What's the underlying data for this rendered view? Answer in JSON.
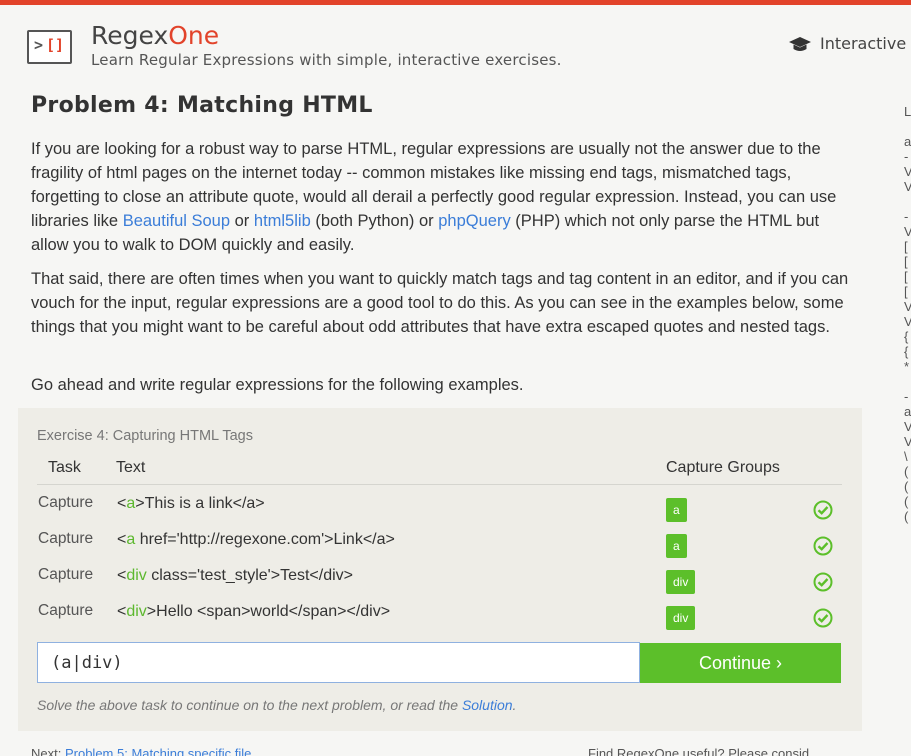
{
  "header": {
    "logo_left": ">",
    "logo_right": "[]",
    "brand_part1": "Regex",
    "brand_part2": "One",
    "tagline": "Learn Regular Expressions with simple, interactive exercises.",
    "nav_icon": "graduation-cap-icon",
    "nav_text": "Interactive T"
  },
  "page": {
    "title": "Problem 4: Matching HTML",
    "para1_a": "If you are looking for a robust way to parse HTML, regular expressions are usually not the answer due to the fragility of html pages on the internet today -- common mistakes like missing end tags, mismatched tags, forgetting to close an attribute quote, would all derail a perfectly good regular expression. Instead, you can use libraries like ",
    "link_bs": "Beautiful Soup",
    "para1_b": " or ",
    "link_html5lib": "html5lib",
    "para1_c": " (both Python) or ",
    "link_phpquery": "phpQuery",
    "para1_d": " (PHP) which not only parse the HTML but allow you to walk to DOM quickly and easily.",
    "para2": "That said, there are often times when you want to quickly match tags and tag content in an editor, and if you can vouch for the input, regular expressions are a good tool to do this. As you can see in the examples below, some things that you might want to be careful about odd attributes that have extra escaped quotes and nested tags.",
    "para3": "Go ahead and write regular expressions for the following examples."
  },
  "sidebar_letters": [
    "L",
    "",
    "a",
    "-",
    "V",
    "V",
    "",
    "-",
    "V",
    "[",
    "[",
    "[",
    "[",
    "V",
    "V",
    "{",
    "{",
    "*",
    "",
    "-",
    "a",
    "V",
    "V",
    "\\",
    "(",
    "(",
    "(",
    "("
  ],
  "exercise": {
    "title": "Exercise 4: Capturing HTML Tags",
    "col_task": "Task",
    "col_text": "Text",
    "col_groups": "Capture Groups",
    "rows": [
      {
        "task": "Capture",
        "pre": "<",
        "hl": "a",
        "post": ">This is a link</a>",
        "group": "a"
      },
      {
        "task": "Capture",
        "pre": "<",
        "hl": "a",
        "post": " href='http://regexone.com'>Link</a>",
        "group": "a"
      },
      {
        "task": "Capture",
        "pre": "<",
        "hl": "div",
        "post": " class='test_style'>Test</div>",
        "group": "div"
      },
      {
        "task": "Capture",
        "pre": "<",
        "hl": "div",
        "post": ">Hello <span>world</span></div>",
        "group": "div"
      }
    ],
    "status_icon": "check-circle-icon",
    "input_value": "(a|div)",
    "continue_label": "Continue ›",
    "hint_text": "Solve the above task to continue on to the next problem, or read the ",
    "hint_link": "Solution",
    "hint_end": "."
  },
  "footer": {
    "next_label": "Next: ",
    "next_link": "Problem 5: Matching specific file",
    "right_text": "Find RegexOne useful? Please consid"
  },
  "colors": {
    "accent_red": "#e2432a",
    "success_green": "#5cbf2a",
    "link_blue": "#3b7dd8",
    "exercise_bg": "#eeede7"
  }
}
